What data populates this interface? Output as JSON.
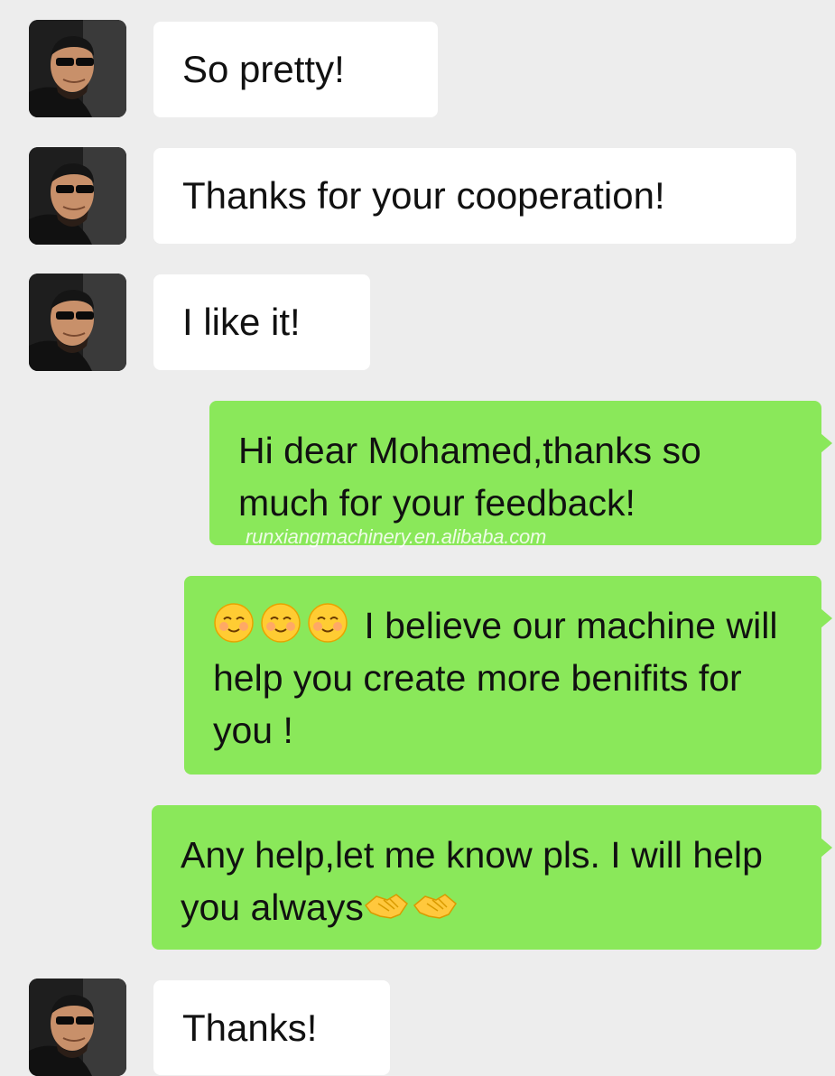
{
  "messages": [
    {
      "side": "in",
      "text": "So pretty!"
    },
    {
      "side": "in",
      "text": "Thanks for your cooperation!"
    },
    {
      "side": "in",
      "text": "I like it!"
    },
    {
      "side": "out",
      "text": "Hi dear Mohamed,thanks so much for your feedback!"
    },
    {
      "side": "out",
      "emoji_prefix": [
        "smiling-face-icon",
        "smiling-face-icon",
        "smiling-face-icon"
      ],
      "text": " I believe our machine will help you create more benifits for you !"
    },
    {
      "side": "out",
      "text": "Any help,let me know pls. I will help you always",
      "emoji_suffix": [
        "handshake-icon",
        "handshake-icon"
      ]
    },
    {
      "side": "in",
      "text": "Thanks!"
    }
  ],
  "watermark": "runxiangmachinery.en.alibaba.com",
  "colors": {
    "background": "#ededed",
    "incoming_bubble": "#ffffff",
    "outgoing_bubble": "#8ae85a"
  }
}
